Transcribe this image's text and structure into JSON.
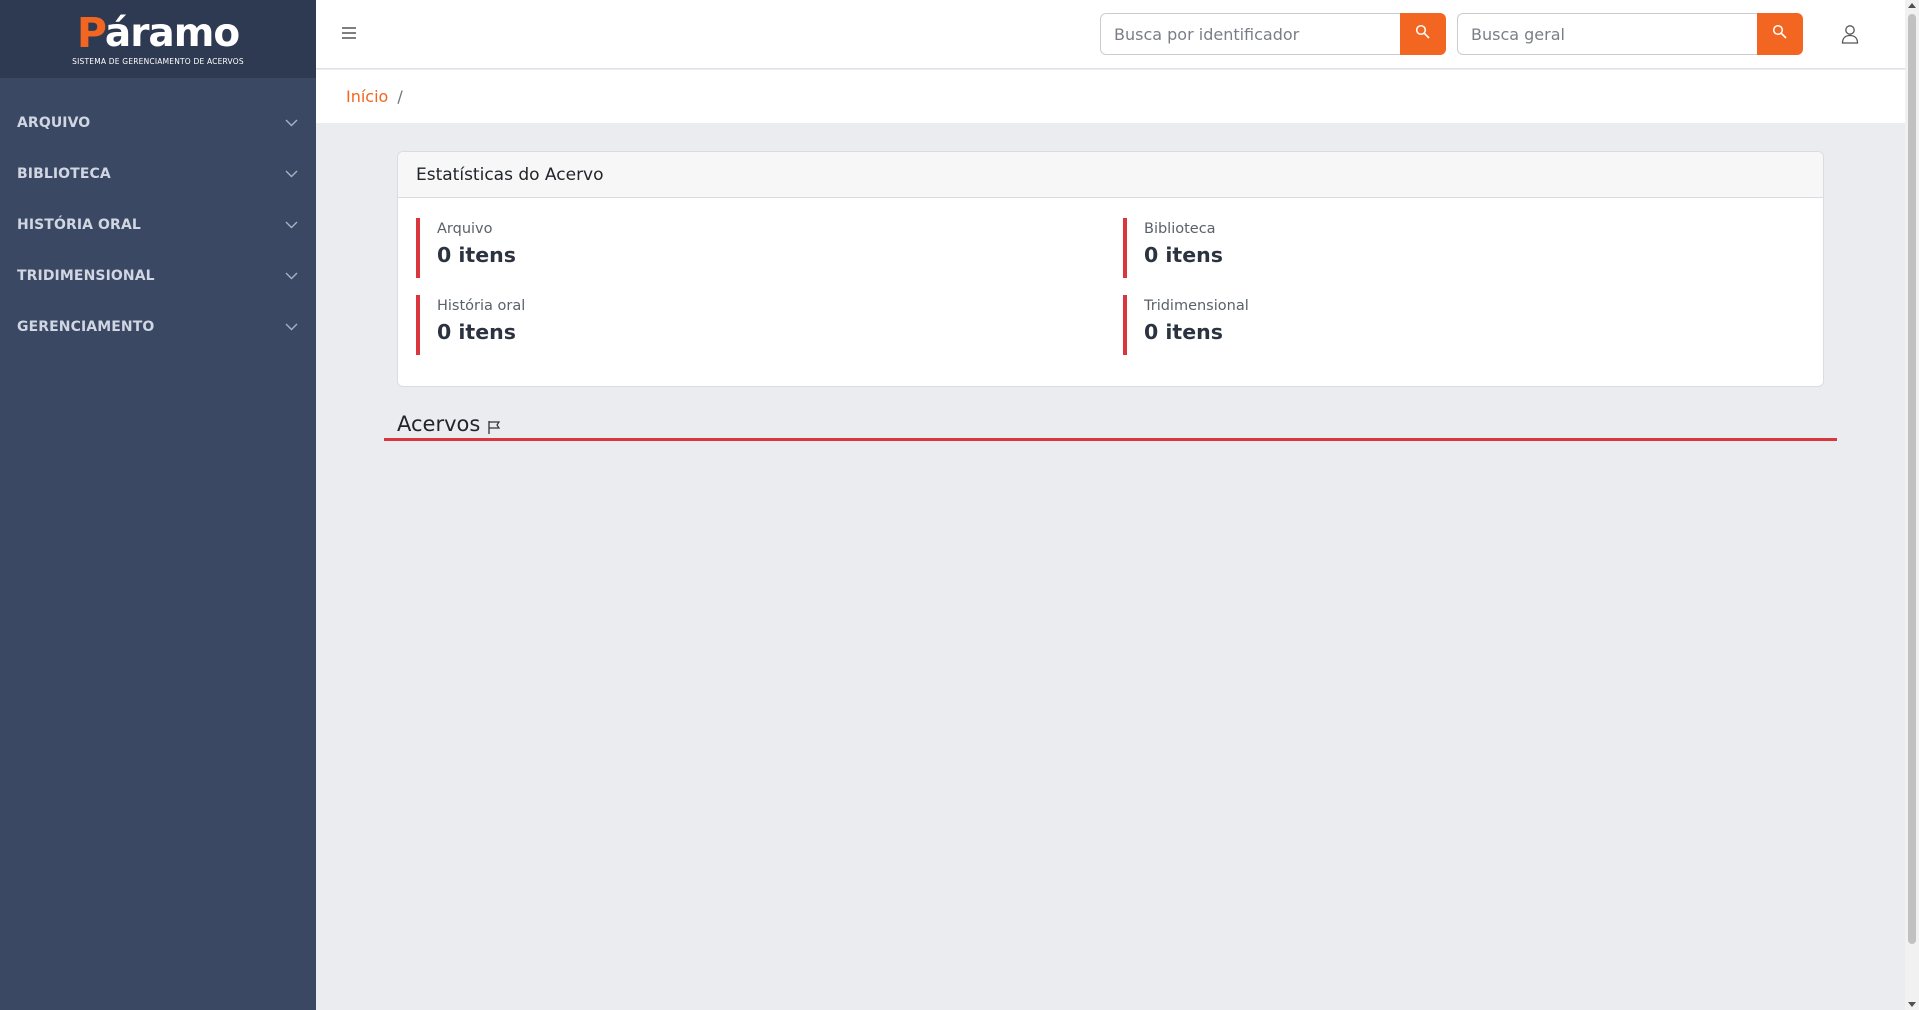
{
  "brand": {
    "logo_initial": "P",
    "logo_rest": "áramo",
    "subtitle": "SISTEMA DE GERENCIAMENTO DE ACERVOS",
    "accent_color": "#f26622"
  },
  "sidebar": {
    "items": [
      {
        "label": "ARQUIVO",
        "icon": "chevron-down-icon"
      },
      {
        "label": "BIBLIOTECA",
        "icon": "chevron-down-icon"
      },
      {
        "label": "HISTÓRIA ORAL",
        "icon": "chevron-down-icon"
      },
      {
        "label": "TRIDIMENSIONAL",
        "icon": "chevron-down-icon"
      },
      {
        "label": "GERENCIAMENTO",
        "icon": "chevron-down-icon"
      }
    ]
  },
  "topbar": {
    "menu_icon": "hamburger-icon",
    "search_id": {
      "placeholder": "Busca por identificador",
      "value": "",
      "icon": "search-icon"
    },
    "search_general": {
      "placeholder": "Busca geral",
      "value": "",
      "icon": "search-icon"
    },
    "user_icon": "user-icon"
  },
  "breadcrumb": {
    "items": [
      {
        "label": "Início"
      }
    ],
    "separator": "/"
  },
  "stats": {
    "title": "Estatísticas do Acervo",
    "accent_color": "#d9363e",
    "items": [
      {
        "label": "Arquivo",
        "value": "0 itens"
      },
      {
        "label": "Biblioteca",
        "value": "0 itens"
      },
      {
        "label": "História oral",
        "value": "0 itens"
      },
      {
        "label": "Tridimensional",
        "value": "0 itens"
      }
    ]
  },
  "acervos": {
    "title": "Acervos",
    "icon": "flag-icon"
  }
}
